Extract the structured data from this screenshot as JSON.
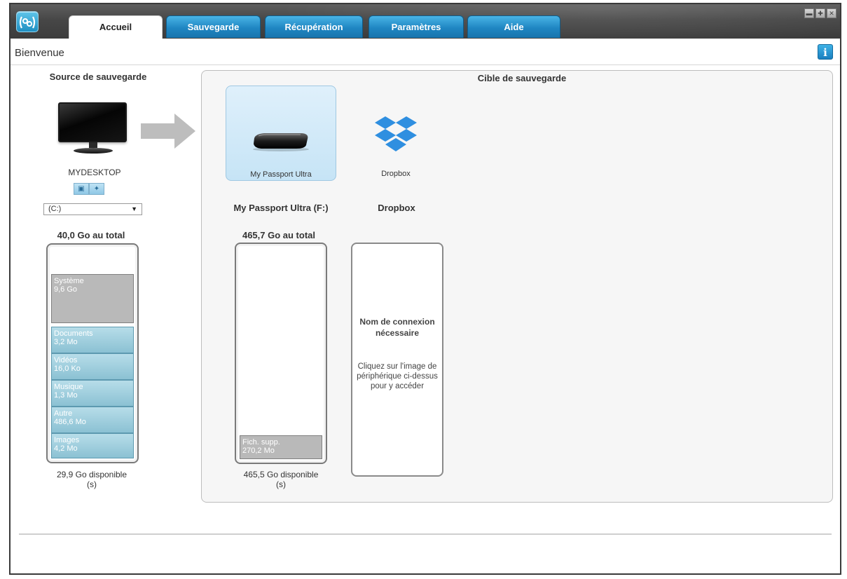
{
  "header": {
    "tabs": [
      {
        "label": "Accueil"
      },
      {
        "label": "Sauvegarde"
      },
      {
        "label": "Récupération"
      },
      {
        "label": "Paramètres"
      },
      {
        "label": "Aide"
      }
    ],
    "active_tab": "Accueil",
    "page_title": "Bienvenue"
  },
  "source": {
    "title": "Source de sauvegarde",
    "computer_name": "MYDESKTOP",
    "drive_selected": "(C:)",
    "total": "40,0 Go au total",
    "segments": [
      {
        "name": "Système",
        "size": "9,6 Go"
      },
      {
        "name": "Documents",
        "size": "3,2 Mo"
      },
      {
        "name": "Vidéos",
        "size": "16,0 Ko"
      },
      {
        "name": "Musique",
        "size": "1,3 Mo"
      },
      {
        "name": "Autre",
        "size": "486,6 Mo"
      },
      {
        "name": "Images",
        "size": "4,2 Mo"
      }
    ],
    "free_line1": "29,9 Go disponible",
    "free_line2": "(s)"
  },
  "target": {
    "title": "Cible de sauvegarde",
    "devices": [
      {
        "label": "My Passport Ultra",
        "heading": "My Passport Ultra (F:)"
      },
      {
        "label": "Dropbox",
        "heading": "Dropbox"
      }
    ],
    "passport": {
      "total": "465,7 Go au total",
      "segment_name": "Fich. supp.",
      "segment_size": "270,2 Mo",
      "free_line1": "465,5 Go disponible",
      "free_line2": "(s)"
    },
    "dropbox": {
      "login_title": "Nom de connexion nécessaire",
      "login_hint": "Cliquez sur l'image de périphérique ci-dessus pour y accéder"
    }
  },
  "colors": {
    "tab_blue": "#1f86c2",
    "segment_blue": "#8bc1d3",
    "segment_gray": "#b9b9b9",
    "tile_highlight": "#c6e4f6"
  },
  "icons": {
    "app": "wd-backup-logo-icon",
    "info": "info-icon",
    "computer": "desktop-computer-icon",
    "arrow": "arrow-right-icon",
    "drive": "external-hard-drive-icon",
    "dropbox": "dropbox-icon"
  }
}
